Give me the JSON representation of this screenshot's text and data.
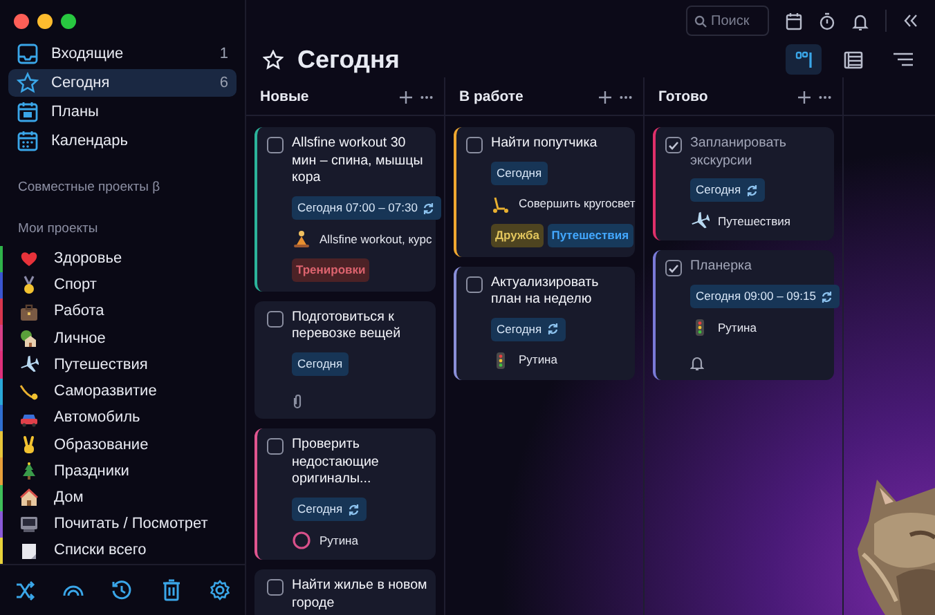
{
  "sidebar": {
    "nav": [
      {
        "label": "Входящие",
        "count": "1",
        "selected": false
      },
      {
        "label": "Сегодня",
        "count": "6",
        "selected": true
      },
      {
        "label": "Планы",
        "selected": false
      },
      {
        "label": "Календарь",
        "selected": false
      }
    ],
    "shared_heading": "Совместные проекты β",
    "projects_heading": "Мои проекты",
    "projects": [
      {
        "label": "Здоровье",
        "color": "#2fb34a"
      },
      {
        "label": "Спорт",
        "color": "#3a56d0"
      },
      {
        "label": "Работа",
        "color": "#d8364e"
      },
      {
        "label": "Личное",
        "color": "#d83f86"
      },
      {
        "label": "Путешествия",
        "color": "#e0307a"
      },
      {
        "label": "Саморазвитие",
        "color": "#2aa8d8"
      },
      {
        "label": "Автомобиль",
        "color": "#2f6fd0"
      },
      {
        "label": "Образование",
        "color": "#e8c53a"
      },
      {
        "label": "Праздники",
        "color": "#e8a03a"
      },
      {
        "label": "Дом",
        "color": "#3fbf5a"
      },
      {
        "label": "Почитать / Посмотрет",
        "color": "#8a5ad8"
      },
      {
        "label": "Списки всего",
        "color": "#e8d23a"
      }
    ]
  },
  "toolbar": {
    "search": {
      "placeholder": "Поиск"
    }
  },
  "title": "Сегодня",
  "views": [
    {
      "selected": true
    },
    {
      "selected": false
    },
    {
      "selected": false
    }
  ],
  "columns": [
    {
      "title": "Новые",
      "cards": [
        {
          "title": "Allsfine workout 30 мин – спина, мышцы кора",
          "done": false,
          "color": "#2bb39a",
          "date": "Сегодня 07:00 – 07:30",
          "repeat": true,
          "project": "Allsfine workout, курс",
          "tags": [
            {
              "label": "Тренировки",
              "color": "#4c2226"
            }
          ]
        },
        {
          "title": "Подготовиться к перевозке вещей",
          "done": false,
          "date": "Сегодня",
          "repeat": false,
          "attachment": true
        },
        {
          "title": "Проверить недостающие оригиналы...",
          "done": false,
          "color": "#e0558f",
          "date": "Сегодня",
          "repeat": true,
          "project": "Рутина"
        },
        {
          "title": "Найти жилье в новом городе",
          "done": false
        }
      ]
    },
    {
      "title": "В работе",
      "cards": [
        {
          "title": "Найти попутчика",
          "done": false,
          "color": "#f0a830",
          "date": "Сегодня",
          "repeat": false,
          "project": "Совершить кругосвет",
          "tags": [
            {
              "label": "Дружба",
              "color": "#4e4420"
            },
            {
              "label": "Путешествия",
              "color": "#173a5c"
            }
          ]
        },
        {
          "title": "Актуализировать план на неделю",
          "done": false,
          "color": "#8a8fd8",
          "date": "Сегодня",
          "repeat": true,
          "project": "Рутина"
        }
      ]
    },
    {
      "title": "Готово",
      "cards": [
        {
          "title": "Запланировать экскурсии",
          "done": true,
          "color": "#e0306a",
          "date": "Сегодня",
          "repeat": true,
          "project": "Путешествия"
        },
        {
          "title": "Планерка",
          "done": true,
          "color": "#7a7ad8",
          "date": "Сегодня 09:00 – 09:15",
          "repeat": true,
          "project": "Рутина",
          "reminder": true
        }
      ]
    }
  ]
}
